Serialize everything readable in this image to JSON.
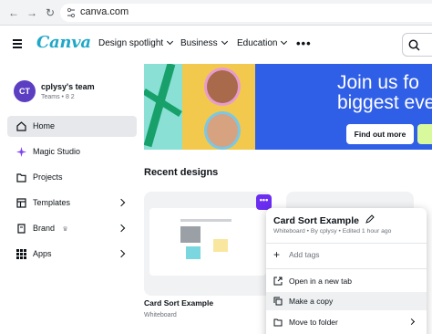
{
  "browser": {
    "url": "canva.com"
  },
  "header": {
    "logo": "Canva",
    "nav": [
      "Design spotlight",
      "Business",
      "Education"
    ]
  },
  "sidebar": {
    "avatar_initials": "CT",
    "team_name": "cplysy's team",
    "team_sub": "Teams • 8 2",
    "items": [
      {
        "label": "Home",
        "icon": "home-icon"
      },
      {
        "label": "Magic Studio",
        "icon": "sparkle-icon"
      },
      {
        "label": "Projects",
        "icon": "folder-icon"
      },
      {
        "label": "Templates",
        "icon": "templates-icon"
      },
      {
        "label": "Brand",
        "icon": "brand-icon"
      },
      {
        "label": "Apps",
        "icon": "apps-icon"
      }
    ]
  },
  "banner": {
    "title_line1": "Join us fo",
    "title_line2": "biggest eve",
    "button": "Find out more"
  },
  "recent": {
    "heading": "Recent designs",
    "card_title": "Card Sort Example",
    "card_sub": "Whiteboard"
  },
  "context_menu": {
    "title": "Card Sort Example",
    "subtitle": "Whiteboard • By cplysy • Edited 1 hour ago",
    "add_tags": "Add tags",
    "open_new_tab": "Open in a new tab",
    "make_copy": "Make a copy",
    "move_to_folder": "Move to folder"
  },
  "colors": {
    "brand": "#1fa8c9",
    "accent_purple": "#6b2df2",
    "banner_blue": "#2f5ee7"
  }
}
